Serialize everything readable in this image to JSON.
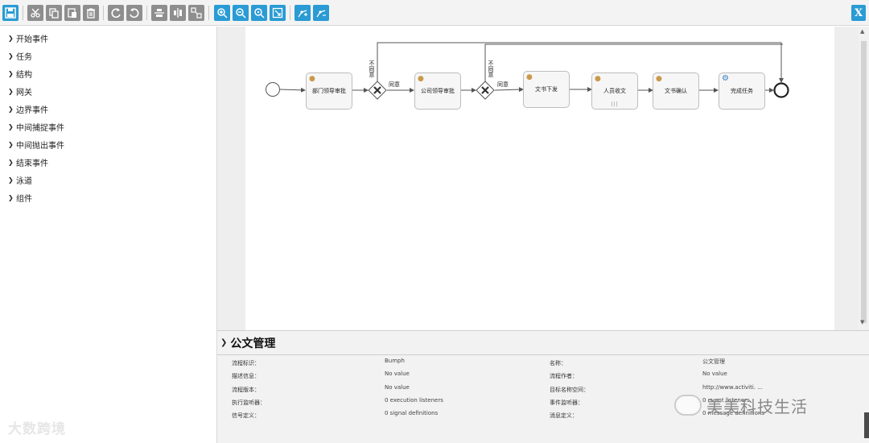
{
  "toolbar": {
    "buttons": [
      {
        "name": "save-button",
        "icon": "floppy-icon"
      },
      {
        "name": "cut-button",
        "icon": "scissors-icon"
      },
      {
        "name": "copy-button",
        "icon": "copy-icon"
      },
      {
        "name": "paste-button",
        "icon": "paste-icon"
      },
      {
        "name": "delete-button",
        "icon": "trash-icon"
      },
      {
        "name": "redo-button",
        "icon": "redo-icon"
      },
      {
        "name": "undo-button",
        "icon": "undo-icon"
      },
      {
        "name": "align-vertical-button",
        "icon": "align-vertical-icon"
      },
      {
        "name": "align-horizontal-button",
        "icon": "align-horizontal-icon"
      },
      {
        "name": "same-size-button",
        "icon": "same-size-icon"
      },
      {
        "name": "zoom-in-button",
        "icon": "zoom-in-icon"
      },
      {
        "name": "zoom-out-button",
        "icon": "zoom-out-icon"
      },
      {
        "name": "zoom-actual-button",
        "icon": "zoom-actual-icon"
      },
      {
        "name": "zoom-fit-button",
        "icon": "zoom-fit-icon"
      },
      {
        "name": "bendpoint-add-button",
        "icon": "bendpoint-add-icon"
      },
      {
        "name": "bendpoint-remove-button",
        "icon": "bendpoint-remove-icon"
      }
    ],
    "close_label": "X",
    "colors": {
      "grey": "#8e8e8e",
      "blue": "#2a9bd4"
    }
  },
  "sidebar": {
    "items": [
      {
        "label": "开始事件"
      },
      {
        "label": "任务"
      },
      {
        "label": "结构"
      },
      {
        "label": "网关"
      },
      {
        "label": "边界事件"
      },
      {
        "label": "中间捕捉事件"
      },
      {
        "label": "中间抛出事件"
      },
      {
        "label": "结束事件"
      },
      {
        "label": "泳道"
      },
      {
        "label": "组件"
      }
    ]
  },
  "diagram": {
    "tasks": [
      {
        "label": "部门领导审批",
        "icon": "user-icon"
      },
      {
        "label": "公司领导审批",
        "icon": "user-icon"
      },
      {
        "label": "文书下发",
        "icon": "user-icon"
      },
      {
        "label": "人员收文",
        "icon": "user-icon",
        "multi_instance": "|||"
      },
      {
        "label": "文书确认",
        "icon": "user-icon"
      },
      {
        "label": "完成任务",
        "icon": "gear-icon"
      }
    ],
    "gateways": [
      {
        "symbol": "X"
      },
      {
        "symbol": "X"
      }
    ],
    "flow_labels": {
      "reject_1": "不同意",
      "approve_1": "同意",
      "reject_2": "不同意",
      "approve_2": "同意"
    }
  },
  "properties": {
    "title": "公文管理",
    "rows": [
      {
        "label": "流程标识：",
        "value": "Bumph",
        "label2": "名称：",
        "value2": "公文管理"
      },
      {
        "label": "描述信息：",
        "value": "No value",
        "label2": "流程作者：",
        "value2": "No value"
      },
      {
        "label": "流程版本：",
        "value": "No value",
        "label2": "目标名称空间：",
        "value2": "http://www.activiti. ..."
      },
      {
        "label": "执行监听器：",
        "value": "0 execution listeners",
        "label2": "事件监听器：",
        "value2": "0 event listeners"
      },
      {
        "label": "信号定义：",
        "value": "0 signal definitions",
        "label2": "消息定义：",
        "value2": "0 message definitions"
      }
    ]
  },
  "watermarks": {
    "left": "大数跨境",
    "right": "美美科技生活"
  }
}
